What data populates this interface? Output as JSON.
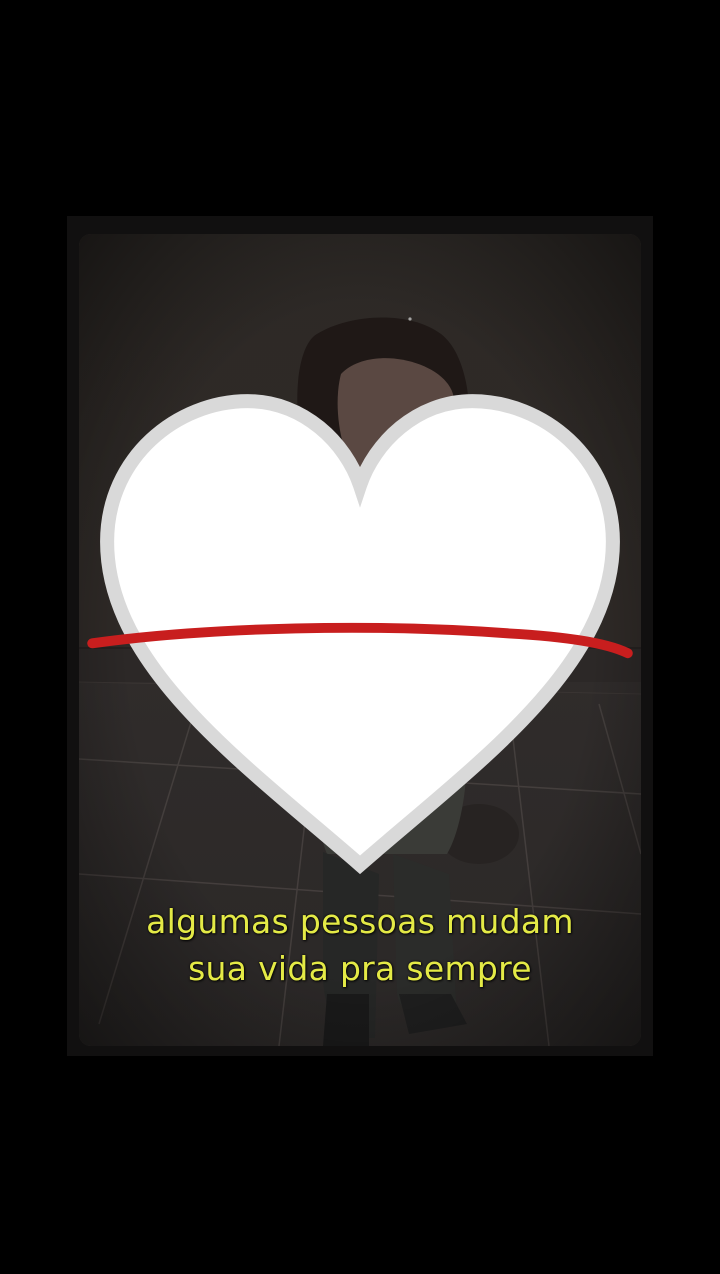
{
  "caption": {
    "line1": "algumas pessoas mudam",
    "line2_start": "sua vida pra ",
    "line2_emphasis": "sempre"
  },
  "heart_icon": "white-heart-emoji",
  "colors": {
    "background": "#000000",
    "frame": "#111010",
    "caption_text": "#e4ea46",
    "underline": "#c81e1e"
  }
}
